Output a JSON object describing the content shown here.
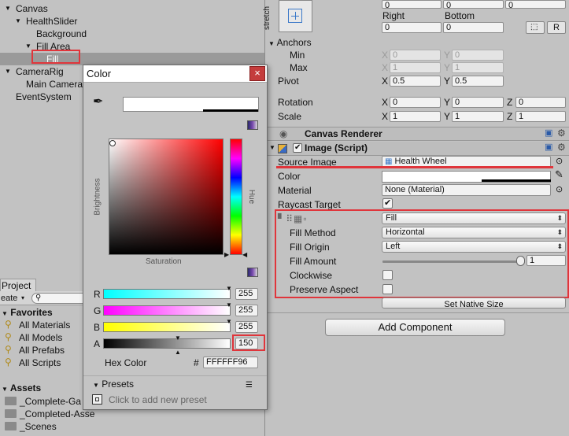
{
  "hierarchy": {
    "items": [
      {
        "label": "Canvas",
        "indent": 0,
        "arrow": "open"
      },
      {
        "label": "HealthSlider",
        "indent": 1,
        "arrow": "open"
      },
      {
        "label": "Background",
        "indent": 2,
        "arrow": ""
      },
      {
        "label": "Fill Area",
        "indent": 2,
        "arrow": "open"
      },
      {
        "label": "Fill",
        "indent": 3,
        "arrow": "",
        "selected": true
      },
      {
        "label": "CameraRig",
        "indent": 0,
        "arrow": "open"
      },
      {
        "label": "Main Camera",
        "indent": 1,
        "arrow": ""
      },
      {
        "label": "EventSystem",
        "indent": 0,
        "arrow": ""
      }
    ]
  },
  "project": {
    "tab": "Project",
    "create": "eate",
    "favorites_title": "Favorites",
    "favorites": [
      "All Materials",
      "All Models",
      "All Prefabs",
      "All Scripts"
    ],
    "assets_title": "Assets",
    "assets": [
      "_Complete-Ga",
      "_Completed-Asse",
      "_Scenes"
    ]
  },
  "color_picker": {
    "title": "Color",
    "close_icon": "×",
    "brightness_label": "Brightness",
    "hue_label": "Hue",
    "saturation_label": "Saturation",
    "channels": [
      {
        "label": "R",
        "value": "255",
        "color": "#00ffff"
      },
      {
        "label": "G",
        "value": "255",
        "color": "#ff00ff"
      },
      {
        "label": "B",
        "value": "255",
        "color": "#ffff00"
      },
      {
        "label": "A",
        "value": "150",
        "color": "#000000"
      }
    ],
    "hex_label": "Hex Color",
    "hash": "#",
    "hex_value": "FFFFFF96",
    "presets_label": "Presets",
    "add_preset": "Click to add new preset"
  },
  "inspector": {
    "rect": {
      "stretch_label": "stretch",
      "top_fields": [
        "0",
        "0",
        "0"
      ],
      "right_label": "Right",
      "bottom_label": "Bottom",
      "right_value": "0",
      "bottom_value": "0",
      "anchors_label": "Anchors",
      "min_label": "Min",
      "max_label": "Max",
      "min_x": "0",
      "min_y": "0",
      "max_x": "1",
      "max_y": "1",
      "pivot_label": "Pivot",
      "pivot_x": "0.5",
      "pivot_y": "0.5",
      "rotation_label": "Rotation",
      "rot_x": "0",
      "rot_y": "0",
      "rot_z": "0",
      "scale_label": "Scale",
      "scale_x": "1",
      "scale_y": "1",
      "scale_z": "1",
      "x": "X",
      "y": "Y",
      "z": "Z",
      "r_btn": "R"
    },
    "canvas_renderer": "Canvas Renderer",
    "image_script": "Image (Script)",
    "source_image_label": "Source Image",
    "source_image_value": "Health Wheel",
    "color_label": "Color",
    "material_label": "Material",
    "material_value": "None (Material)",
    "raycast_label": "Raycast Target",
    "image_type_value": "Fill",
    "fill_method_label": "Fill Method",
    "fill_method_value": "Horizontal",
    "fill_origin_label": "Fill Origin",
    "fill_origin_value": "Left",
    "fill_amount_label": "Fill Amount",
    "fill_amount_value": "1",
    "fill_amount_fraction": 1,
    "clockwise_label": "Clockwise",
    "preserve_label": "Preserve Aspect",
    "native_size_btn": "Set Native Size",
    "add_component_btn": "Add Component"
  },
  "colors": {
    "highlight": "#e0353b",
    "selection": "#9a9a9a"
  }
}
